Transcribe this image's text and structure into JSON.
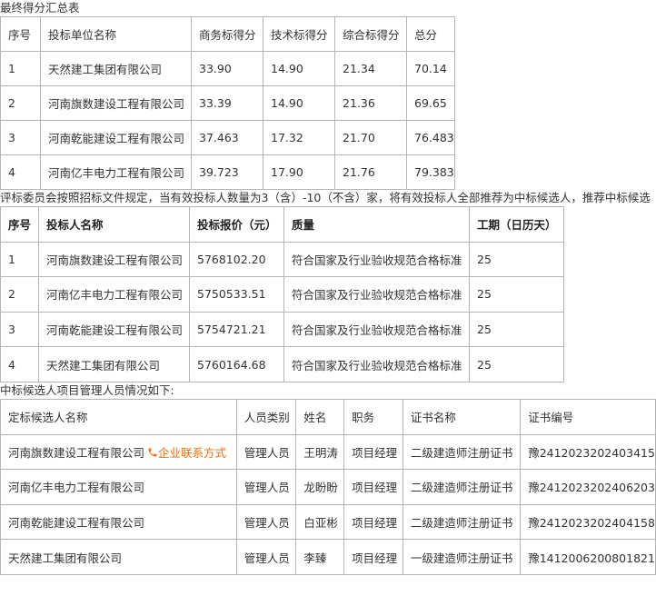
{
  "caption1": "最终得分汇总表",
  "table1": {
    "headers": [
      "序号",
      "投标单位名称",
      "商务标得分",
      "技术标得分",
      "综合标得分",
      "总分"
    ],
    "rows": [
      [
        "1",
        "天然建工集团有限公司",
        "33.90",
        "14.90",
        "21.34",
        "70.14"
      ],
      [
        "2",
        "河南旗数建设工程有限公司",
        "33.39",
        "14.90",
        "21.36",
        "69.65"
      ],
      [
        "3",
        "河南乾能建设工程有限公司",
        "37.463",
        "17.32",
        "21.70",
        "76.483"
      ],
      [
        "4",
        "河南亿丰电力工程有限公司",
        "39.723",
        "17.90",
        "21.76",
        "79.383"
      ]
    ]
  },
  "caption2": "评标委员会按照招标文件规定，当有效投标人数量为3（含）-10（不含）家，将有效投标人全部推荐为中标候选人，推荐中标候选",
  "table2": {
    "headers": [
      "序号",
      "投标人名称",
      "投标报价（元）",
      "质量",
      "工期（日历天）"
    ],
    "rows": [
      [
        "1",
        "河南旗数建设工程有限公司",
        "5768102.20",
        "符合国家及行业验收规范合格标准",
        "25"
      ],
      [
        "2",
        "河南亿丰电力工程有限公司",
        "5750533.51",
        "符合国家及行业验收规范合格标准",
        "25"
      ],
      [
        "3",
        "河南乾能建设工程有限公司",
        "5754721.21",
        "符合国家及行业验收规范合格标准",
        "25"
      ],
      [
        "4",
        "天然建工集团有限公司",
        "5760164.68",
        "符合国家及行业验收规范合格标准",
        "25"
      ]
    ]
  },
  "caption3": "中标候选人项目管理人员情况如下:",
  "table3": {
    "headers": [
      "定标候选人名称",
      "人员类别",
      "姓名",
      "职务",
      "证书名称",
      "证书编号"
    ],
    "contact_link": "企业联系方式",
    "contact_color": "#ff6a00",
    "contact_icon": "phone-icon",
    "rows": [
      [
        "河南旗数建设工程有限公司",
        "管理人员",
        "王明涛",
        "项目经理",
        "二级建造师注册证书",
        "豫2412023202403415"
      ],
      [
        "河南亿丰电力工程有限公司",
        "管理人员",
        "龙盼盼",
        "项目经理",
        "二级建造师注册证书",
        "豫2412023202406203"
      ],
      [
        "河南乾能建设工程有限公司",
        "管理人员",
        "白亚彬",
        "项目经理",
        "二级建造师注册证书",
        "豫2412023202404158"
      ],
      [
        "天然建工集团有限公司",
        "管理人员",
        "李臻",
        "项目经理",
        "一级建造师注册证书",
        "豫1412006200801821"
      ]
    ]
  }
}
